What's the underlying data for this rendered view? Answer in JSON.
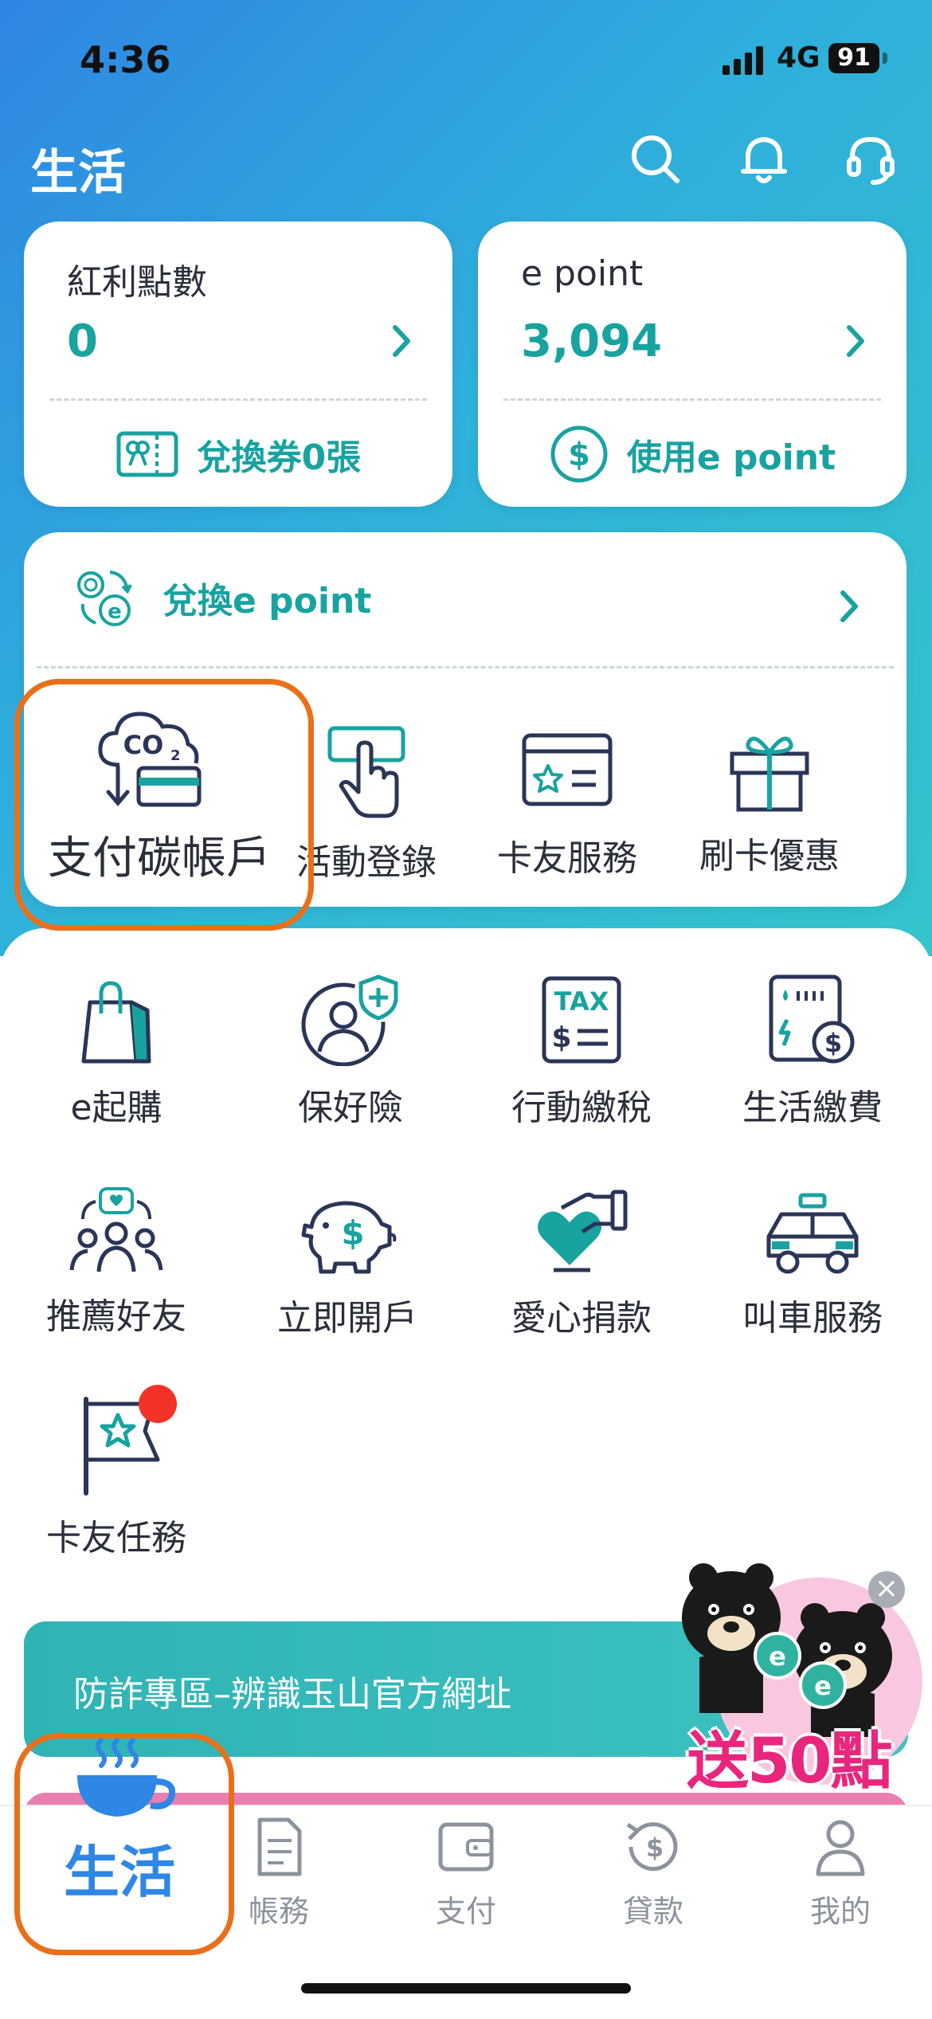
{
  "status": {
    "time": "4:36",
    "network": "4G",
    "battery": "91"
  },
  "header": {
    "title": "生活"
  },
  "points": {
    "bonus": {
      "label": "紅利點數",
      "value": "0",
      "action": "兌換券0張"
    },
    "epoint": {
      "label": "e point",
      "value": "3,094",
      "action": "使用e point"
    }
  },
  "exchange": {
    "label": "兌換e point"
  },
  "quick": [
    {
      "label": "支付碳帳戶"
    },
    {
      "label": "活動登錄"
    },
    {
      "label": "卡友服務"
    },
    {
      "label": "刷卡優惠"
    }
  ],
  "services": [
    {
      "label": "e起購"
    },
    {
      "label": "保好險"
    },
    {
      "label": "行動繳稅"
    },
    {
      "label": "生活繳費"
    },
    {
      "label": "推薦好友"
    },
    {
      "label": "立即開戶"
    },
    {
      "label": "愛心捐款"
    },
    {
      "label": "叫車服務"
    },
    {
      "label": "卡友任務"
    }
  ],
  "banner": {
    "text": "防詐專區–辨識玉山官方網址"
  },
  "promo": {
    "text": "送50點",
    "close": "×"
  },
  "tabs": [
    {
      "label": "生活"
    },
    {
      "label": "帳務"
    },
    {
      "label": "支付"
    },
    {
      "label": "貸款"
    },
    {
      "label": "我的"
    }
  ],
  "colors": {
    "accent": "#18a3a0",
    "navy": "#2b3557",
    "highlight": "#e8701a",
    "tab_active": "#2e86e5"
  }
}
